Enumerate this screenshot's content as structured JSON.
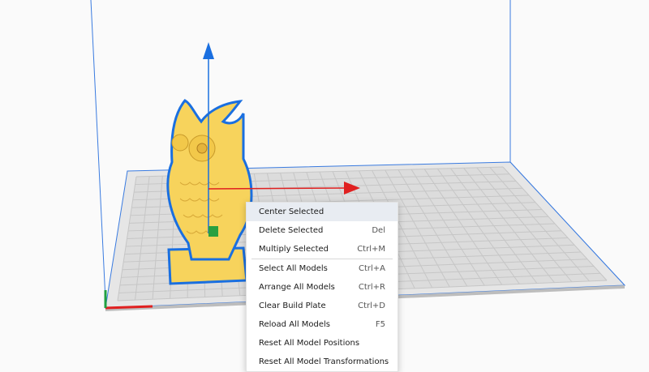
{
  "context_menu": {
    "groups": [
      [
        {
          "label": "Center Selected",
          "shortcut": ""
        },
        {
          "label": "Delete Selected",
          "shortcut": "Del"
        },
        {
          "label": "Multiply Selected",
          "shortcut": "Ctrl+M"
        }
      ],
      [
        {
          "label": "Select All Models",
          "shortcut": "Ctrl+A"
        },
        {
          "label": "Arrange All Models",
          "shortcut": "Ctrl+R"
        },
        {
          "label": "Clear Build Plate",
          "shortcut": "Ctrl+D"
        },
        {
          "label": "Reload All Models",
          "shortcut": "F5"
        },
        {
          "label": "Reset All Model Positions",
          "shortcut": ""
        },
        {
          "label": "Reset All Model Transformations",
          "shortcut": ""
        }
      ]
    ]
  },
  "colors": {
    "build_volume_edge": "#3a7be0",
    "plate_fill": "#dcdcdc",
    "plate_grid": "#c4c4c4",
    "model_fill": "#f7d35c",
    "model_outline": "#1a6fe0",
    "axis_x": "#e02020",
    "axis_y": "#1a6fe0",
    "axis_z": "#20a040"
  },
  "icons": {
    "gizmo_up_arrow": "arrow-up-icon",
    "gizmo_right_arrow": "arrow-right-icon",
    "gizmo_center": "gizmo-handle-icon"
  }
}
